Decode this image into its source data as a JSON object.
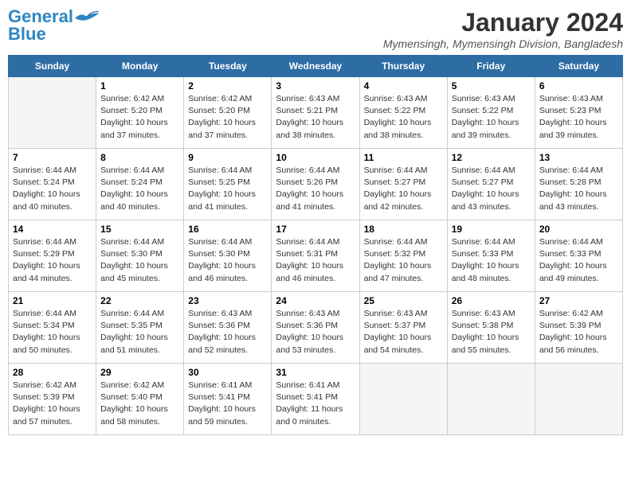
{
  "header": {
    "logo_line1": "General",
    "logo_line2": "Blue",
    "month_title": "January 2024",
    "subtitle": "Mymensingh, Mymensingh Division, Bangladesh"
  },
  "weekdays": [
    "Sunday",
    "Monday",
    "Tuesday",
    "Wednesday",
    "Thursday",
    "Friday",
    "Saturday"
  ],
  "weeks": [
    [
      {
        "day": "",
        "info": ""
      },
      {
        "day": "1",
        "info": "Sunrise: 6:42 AM\nSunset: 5:20 PM\nDaylight: 10 hours\nand 37 minutes."
      },
      {
        "day": "2",
        "info": "Sunrise: 6:42 AM\nSunset: 5:20 PM\nDaylight: 10 hours\nand 37 minutes."
      },
      {
        "day": "3",
        "info": "Sunrise: 6:43 AM\nSunset: 5:21 PM\nDaylight: 10 hours\nand 38 minutes."
      },
      {
        "day": "4",
        "info": "Sunrise: 6:43 AM\nSunset: 5:22 PM\nDaylight: 10 hours\nand 38 minutes."
      },
      {
        "day": "5",
        "info": "Sunrise: 6:43 AM\nSunset: 5:22 PM\nDaylight: 10 hours\nand 39 minutes."
      },
      {
        "day": "6",
        "info": "Sunrise: 6:43 AM\nSunset: 5:23 PM\nDaylight: 10 hours\nand 39 minutes."
      }
    ],
    [
      {
        "day": "7",
        "info": "Sunrise: 6:44 AM\nSunset: 5:24 PM\nDaylight: 10 hours\nand 40 minutes."
      },
      {
        "day": "8",
        "info": "Sunrise: 6:44 AM\nSunset: 5:24 PM\nDaylight: 10 hours\nand 40 minutes."
      },
      {
        "day": "9",
        "info": "Sunrise: 6:44 AM\nSunset: 5:25 PM\nDaylight: 10 hours\nand 41 minutes."
      },
      {
        "day": "10",
        "info": "Sunrise: 6:44 AM\nSunset: 5:26 PM\nDaylight: 10 hours\nand 41 minutes."
      },
      {
        "day": "11",
        "info": "Sunrise: 6:44 AM\nSunset: 5:27 PM\nDaylight: 10 hours\nand 42 minutes."
      },
      {
        "day": "12",
        "info": "Sunrise: 6:44 AM\nSunset: 5:27 PM\nDaylight: 10 hours\nand 43 minutes."
      },
      {
        "day": "13",
        "info": "Sunrise: 6:44 AM\nSunset: 5:28 PM\nDaylight: 10 hours\nand 43 minutes."
      }
    ],
    [
      {
        "day": "14",
        "info": "Sunrise: 6:44 AM\nSunset: 5:29 PM\nDaylight: 10 hours\nand 44 minutes."
      },
      {
        "day": "15",
        "info": "Sunrise: 6:44 AM\nSunset: 5:30 PM\nDaylight: 10 hours\nand 45 minutes."
      },
      {
        "day": "16",
        "info": "Sunrise: 6:44 AM\nSunset: 5:30 PM\nDaylight: 10 hours\nand 46 minutes."
      },
      {
        "day": "17",
        "info": "Sunrise: 6:44 AM\nSunset: 5:31 PM\nDaylight: 10 hours\nand 46 minutes."
      },
      {
        "day": "18",
        "info": "Sunrise: 6:44 AM\nSunset: 5:32 PM\nDaylight: 10 hours\nand 47 minutes."
      },
      {
        "day": "19",
        "info": "Sunrise: 6:44 AM\nSunset: 5:33 PM\nDaylight: 10 hours\nand 48 minutes."
      },
      {
        "day": "20",
        "info": "Sunrise: 6:44 AM\nSunset: 5:33 PM\nDaylight: 10 hours\nand 49 minutes."
      }
    ],
    [
      {
        "day": "21",
        "info": "Sunrise: 6:44 AM\nSunset: 5:34 PM\nDaylight: 10 hours\nand 50 minutes."
      },
      {
        "day": "22",
        "info": "Sunrise: 6:44 AM\nSunset: 5:35 PM\nDaylight: 10 hours\nand 51 minutes."
      },
      {
        "day": "23",
        "info": "Sunrise: 6:43 AM\nSunset: 5:36 PM\nDaylight: 10 hours\nand 52 minutes."
      },
      {
        "day": "24",
        "info": "Sunrise: 6:43 AM\nSunset: 5:36 PM\nDaylight: 10 hours\nand 53 minutes."
      },
      {
        "day": "25",
        "info": "Sunrise: 6:43 AM\nSunset: 5:37 PM\nDaylight: 10 hours\nand 54 minutes."
      },
      {
        "day": "26",
        "info": "Sunrise: 6:43 AM\nSunset: 5:38 PM\nDaylight: 10 hours\nand 55 minutes."
      },
      {
        "day": "27",
        "info": "Sunrise: 6:42 AM\nSunset: 5:39 PM\nDaylight: 10 hours\nand 56 minutes."
      }
    ],
    [
      {
        "day": "28",
        "info": "Sunrise: 6:42 AM\nSunset: 5:39 PM\nDaylight: 10 hours\nand 57 minutes."
      },
      {
        "day": "29",
        "info": "Sunrise: 6:42 AM\nSunset: 5:40 PM\nDaylight: 10 hours\nand 58 minutes."
      },
      {
        "day": "30",
        "info": "Sunrise: 6:41 AM\nSunset: 5:41 PM\nDaylight: 10 hours\nand 59 minutes."
      },
      {
        "day": "31",
        "info": "Sunrise: 6:41 AM\nSunset: 5:41 PM\nDaylight: 11 hours\nand 0 minutes."
      },
      {
        "day": "",
        "info": ""
      },
      {
        "day": "",
        "info": ""
      },
      {
        "day": "",
        "info": ""
      }
    ]
  ],
  "colors": {
    "header_bg": "#2e6da4",
    "header_text": "#ffffff",
    "title_color": "#333333",
    "subtitle_color": "#555555"
  }
}
